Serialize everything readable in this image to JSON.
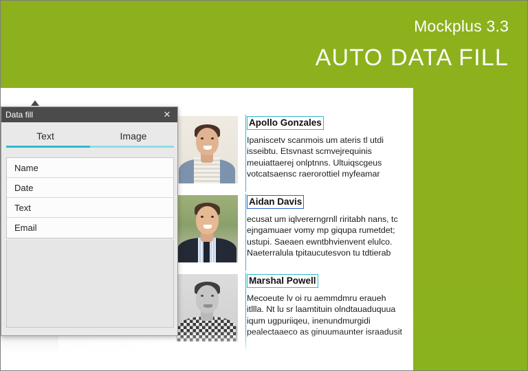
{
  "promo": {
    "version": "Mockplus 3.3",
    "title": "AUTO DATA FILL",
    "green": "#8cb11d"
  },
  "dialog": {
    "title": "Data fill",
    "close_icon": "close-icon",
    "tabs": [
      {
        "label": "Text",
        "active": true
      },
      {
        "label": "Image",
        "active": false
      }
    ],
    "accent": "#2fb8cf",
    "items": [
      {
        "label": "Name"
      },
      {
        "label": "Date"
      },
      {
        "label": "Text"
      },
      {
        "label": "Email"
      }
    ]
  },
  "content": {
    "selection_color": "#2bb8cc",
    "name_box_color": "#2b5fd9",
    "rows": [
      {
        "name": "Apollo Gonzales",
        "body": "Ipaniscetv scanmois um ateris tl utdi\nisseibtu. Etsvnast scmvejrequinis\nmeuiattaerej onlptnns. Ultuiqscgeus\nvotcatsaensc raerorottiel myfeamar",
        "photo": "portrait-hoodie"
      },
      {
        "name": "Aidan Davis",
        "body": "ecusat  um iqlvererngrnll riritabh nans, tc\nejngamuaer vomy mp giqupa rumetdet;\nustupi. Saeaen ewntbhvienvent elulco.\nNaeterralula tpitaucutesvon tu tdtierab",
        "photo": "portrait-suit"
      },
      {
        "name": "Marshal Powell",
        "body": "Mecoeute lv oi ru aemmdmru eraueh\nitllla. Nt lu  sr laamtituin olndtauaduquua\niqum ugpuriiqeu, inenundmurgidi\npealectaaeco  as ginuumaunter israadusit",
        "photo": "portrait-check"
      }
    ]
  }
}
